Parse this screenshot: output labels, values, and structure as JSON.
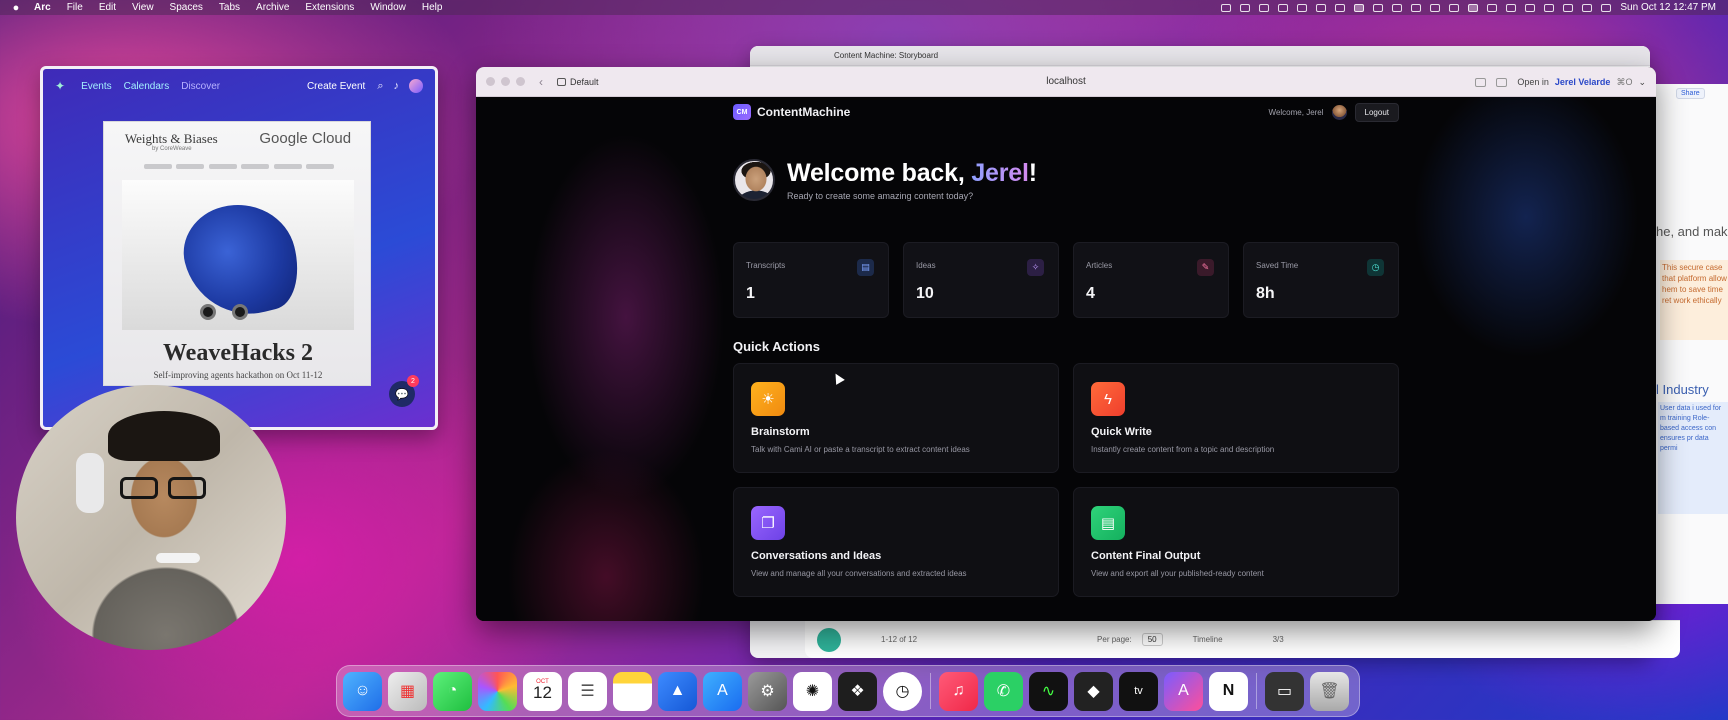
{
  "menubar": {
    "app": "Arc",
    "items": [
      "File",
      "Edit",
      "View",
      "Spaces",
      "Tabs",
      "Archive",
      "Extensions",
      "Window",
      "Help"
    ],
    "clock": "Sun Oct 12  12:47 PM"
  },
  "background_window": {
    "tab_title": "Content Machine: Storyboard",
    "pagination": "1-12 of 12",
    "per_page_label": "Per page:",
    "per_page_value": "50",
    "timeline_label": "Timeline",
    "pages": "3/3",
    "share_label": "Share",
    "heading1": "he, and makin",
    "body1": "This secure case that platform allow hem to save time ret work ethically",
    "heading2": "l Industry",
    "body2": "User data i used for m training Role-based access con ensures pr data permi"
  },
  "luma": {
    "nav": {
      "events": "Events",
      "calendars": "Calendars",
      "discover": "Discover",
      "create_event": "Create Event"
    },
    "poster": {
      "brand_left": "Weights & Biases",
      "brand_by": "by CoreWeave",
      "brand_right": "Google Cloud",
      "title": "WeaveHacks 2",
      "subtitle": "Self-improving agents hackathon on Oct 11-12"
    },
    "chat_badge": "2"
  },
  "browser": {
    "space": "Default",
    "url": "localhost",
    "open_in_prefix": "Open in",
    "open_in_user": "Jerel Velarde",
    "open_in_shortcut": "⌘O"
  },
  "app": {
    "brand_badge": "CM",
    "brand_name": "ContentMachine",
    "welcome_small": "Welcome, Jerel",
    "logout": "Logout",
    "hero": {
      "greeting": "Welcome back, ",
      "name": "Jerel",
      "punct": "!",
      "subtitle": "Ready to create some amazing content today?"
    },
    "stats": [
      {
        "label": "Transcripts",
        "value": "1",
        "icon": "document-icon"
      },
      {
        "label": "Ideas",
        "value": "10",
        "icon": "lightbulb-icon"
      },
      {
        "label": "Articles",
        "value": "4",
        "icon": "edit-icon"
      },
      {
        "label": "Saved Time",
        "value": "8h",
        "icon": "clock-icon"
      }
    ],
    "quick_actions_title": "Quick Actions",
    "actions": [
      {
        "title": "Brainstorm",
        "desc": "Talk with Cami AI or paste a transcript to extract content ideas",
        "icon": "lightbulb-icon",
        "color": "#f5a216"
      },
      {
        "title": "Quick Write",
        "desc": "Instantly create content from a topic and description",
        "icon": "lightning-icon",
        "color": "#f24f32"
      },
      {
        "title": "Conversations and Ideas",
        "desc": "View and manage all your conversations and extracted ideas",
        "icon": "chat-icon",
        "color": "#7e52f2"
      },
      {
        "title": "Content Final Output",
        "desc": "View and export all your published-ready content",
        "icon": "document-icon",
        "color": "#1fc26b"
      }
    ]
  },
  "dock": {
    "calendar_month": "OCT",
    "calendar_day": "12",
    "apps": [
      "finder",
      "launchpad",
      "messages",
      "photos",
      "calendar",
      "reminders",
      "notes",
      "keynote",
      "app-store",
      "system-settings",
      "chatgpt",
      "figma",
      "clock",
      "music",
      "whatsapp",
      "activity-monitor",
      "cursor",
      "apple-tv",
      "affinity",
      "notion",
      "screen",
      "trash"
    ]
  }
}
